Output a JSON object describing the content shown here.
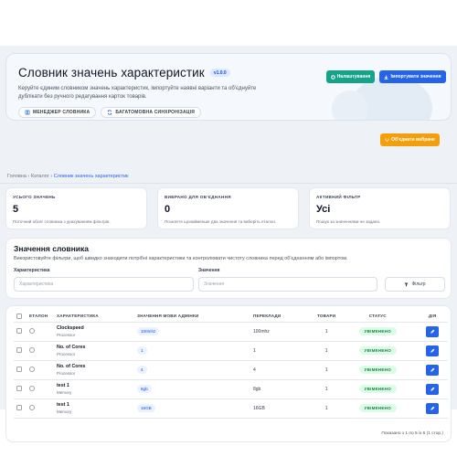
{
  "header": {
    "title": "Словник значень характеристик",
    "version": "v1.0.0",
    "description": "Керуйте єдиним словником значень характеристик, імпортуйте наявні варіанти та об'єднуйте дублікати без ручного редагування карток товарів.",
    "chips": [
      {
        "icon": "book-icon",
        "label": "МЕНЕДЖЕР СЛОВНИКА"
      },
      {
        "icon": "sync-icon",
        "label": "БАГАТОМОВНА СИНХРОНІЗАЦІЯ"
      }
    ],
    "buttons": {
      "settings": "Налаштування",
      "import": "Імпортувати значення",
      "merge": "Об'єднати вибране"
    }
  },
  "breadcrumb": {
    "home": "Головна",
    "sep": "›",
    "catalog": "Каталог",
    "current": "Словник значень характеристик"
  },
  "stats": [
    {
      "label": "УСЬОГО ЗНАЧЕНЬ",
      "value": "5",
      "sub": "Поточний обсяг словника з урахуванням фільтрів."
    },
    {
      "label": "ВИБРАНО ДЛЯ ОБ'ЄДНАННЯ",
      "value": "0",
      "sub": "Позначте щонайменше два значення та виберіть еталон."
    },
    {
      "label": "АКТИВНИЙ ФІЛЬТР",
      "value": "Усі",
      "sub": "Пошук за значеннями не задано."
    }
  ],
  "filters": {
    "title": "Значення словника",
    "description": "Використовуйте фільтри, щоб швидко знаходити потрібні характеристики та контролювати чистоту словника перед об'єднанням або імпортом.",
    "characteristic_label": "Характеристика",
    "characteristic_placeholder": "Характеристика",
    "value_label": "Значення",
    "value_placeholder": "Значення",
    "filter_button": "Фільтр"
  },
  "table": {
    "columns": [
      "",
      "ЕТАЛОН",
      "ХАРАКТЕРИСТИКА",
      "ЗНАЧЕННЯ МОВИ АДМІНКИ",
      "ПЕРЕКЛАДИ",
      "ТОВАРИ",
      "СТАТУС",
      "ДІЯ"
    ],
    "rows": [
      {
        "name": "Clockspeed",
        "group": "Processor",
        "value": "100mhz",
        "translation": "100mhz",
        "products": "1",
        "status": "УВІМКНЕНО"
      },
      {
        "name": "No. of Cores",
        "group": "Processor",
        "value": "1",
        "translation": "1",
        "products": "1",
        "status": "УВІМКНЕНО"
      },
      {
        "name": "No. of Cores",
        "group": "Processor",
        "value": "4",
        "translation": "4",
        "products": "1",
        "status": "УВІМКНЕНО"
      },
      {
        "name": "test 1",
        "group": "Memory",
        "value": "8gb",
        "translation": "8gb",
        "products": "1",
        "status": "УВІМКНЕНО"
      },
      {
        "name": "test 1",
        "group": "Memory",
        "value": "16GB",
        "translation": "16GB",
        "products": "1",
        "status": "УВІМКНЕНО"
      }
    ],
    "pagination": "Показано з 1 по 5 із 5 (1 стор.)"
  },
  "colors": {
    "primary": "#2563eb",
    "teal": "#15a38a",
    "amber": "#f59e0b",
    "status_bg": "#dcfce7",
    "status_text": "#15803d"
  }
}
